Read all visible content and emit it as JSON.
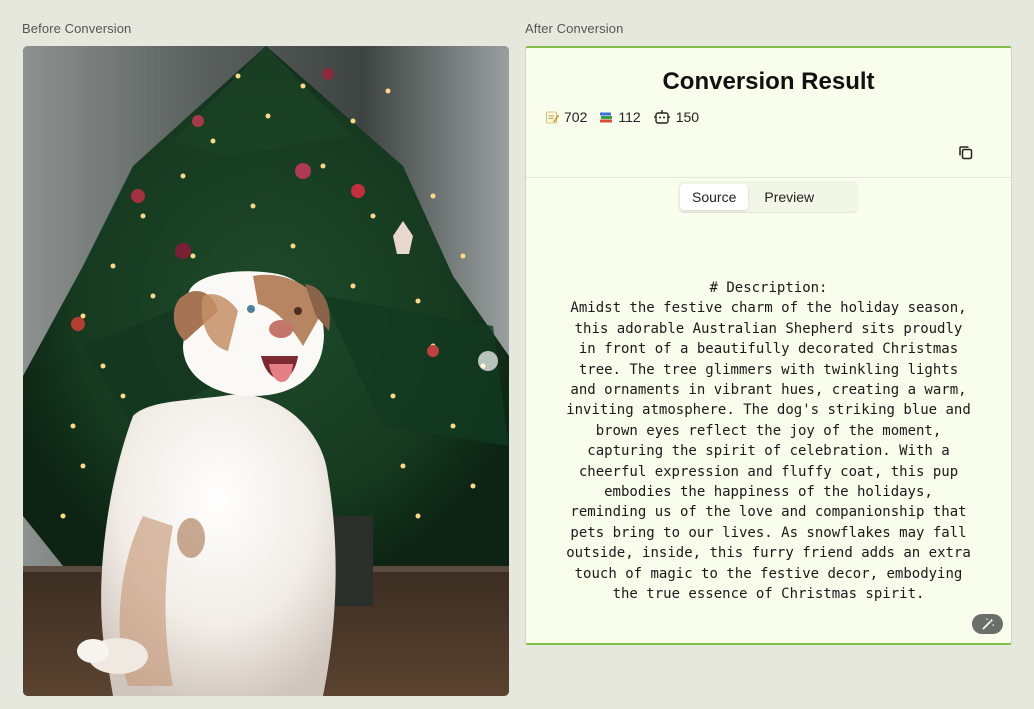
{
  "labels": {
    "before": "Before Conversion",
    "after": "After Conversion"
  },
  "photo": {
    "alt": "Australian Shepherd sitting in front of a decorated Christmas tree"
  },
  "result": {
    "title": "Conversion Result",
    "stats": [
      {
        "icon": "memo-icon",
        "value": "702"
      },
      {
        "icon": "books-icon",
        "value": "112"
      },
      {
        "icon": "robot-icon",
        "value": "150"
      }
    ],
    "tabs": [
      {
        "label": "Source",
        "active": true
      },
      {
        "label": "Preview",
        "active": false
      }
    ],
    "content": "# Description:\nAmidst the festive charm of the holiday season,\nthis adorable Australian Shepherd sits proudly\nin front of a beautifully decorated Christmas\ntree. The tree glimmers with twinkling lights\nand ornaments in vibrant hues, creating a warm,\ninviting atmosphere. The dog's striking blue and\nbrown eyes reflect the joy of the moment,\ncapturing the spirit of celebration. With a\ncheerful expression and fluffy coat, this pup\nembodies the happiness of the holidays,\nreminding us of the love and companionship that\npets bring to our lives. As snowflakes may fall\noutside, inside, this furry friend adds an extra\ntouch of magic to the festive decor, embodying\nthe true essence of Christmas spirit."
  },
  "colors": {
    "accent": "#7fbf4a",
    "panel_bg": "#f8fdec",
    "page_bg": "#e6e8de"
  }
}
